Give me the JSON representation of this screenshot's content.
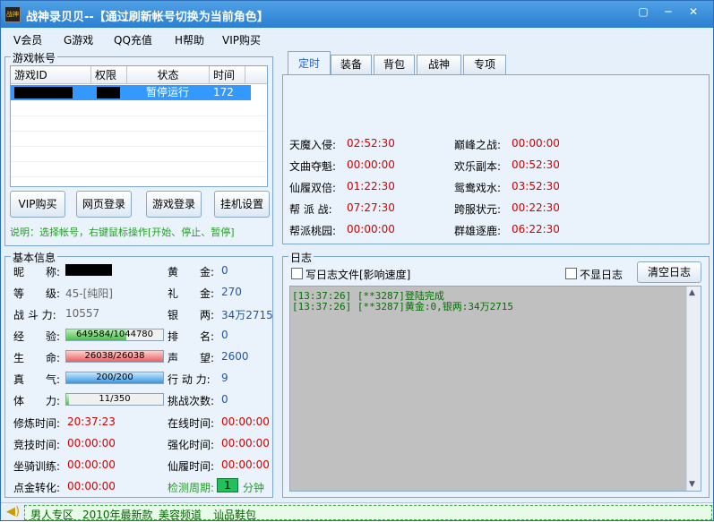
{
  "window": {
    "title": "战神录贝贝--【通过刷新帐号切换为当前角色】",
    "icon_label": "战神"
  },
  "menu": [
    "V会员",
    "G游戏",
    "QQ充值",
    "H帮助",
    "VIP购买"
  ],
  "accounts": {
    "title": "游戏帐号",
    "columns": [
      "游戏ID",
      "权限",
      "状态",
      "时间"
    ],
    "rows": [
      {
        "id": "",
        "perm": "",
        "status": "暂停运行",
        "time": "172"
      }
    ],
    "buttons": [
      "VIP购买",
      "网页登录",
      "游戏登录",
      "挂机设置"
    ],
    "hint": "说明：选择帐号，右键鼠标操作[开始、停止、暂停]"
  },
  "tabs": [
    "定时",
    "装备",
    "背包",
    "战神",
    "专项"
  ],
  "timers": [
    {
      "label": "天魔入侵:",
      "value": "02:52:30"
    },
    {
      "label": "巅峰之战:",
      "value": "00:00:00"
    },
    {
      "label": "文曲夺魁:",
      "value": "00:00:00"
    },
    {
      "label": "欢乐副本:",
      "value": "00:52:30"
    },
    {
      "label": "仙履双倍:",
      "value": "01:22:30"
    },
    {
      "label": "鸳鸯戏水:",
      "value": "03:52:30"
    },
    {
      "label": "帮 派 战:",
      "value": "07:27:30"
    },
    {
      "label": "跨服状元:",
      "value": "00:22:30"
    },
    {
      "label": "帮派桃园:",
      "value": "00:00:00"
    },
    {
      "label": "群雄逐鹿:",
      "value": "06:22:30"
    }
  ],
  "basic": {
    "title": "基本信息",
    "nickname_label": "昵　　称:",
    "level_label": "等　　级:",
    "level": "45-[纯阳]",
    "power_label": "战 斗 力:",
    "power": "10557",
    "exp_label": "经　　验:",
    "exp": "649584/1044780",
    "exp_pct": 62,
    "hp_label": "生　　命:",
    "hp": "26038/26038",
    "hp_pct": 100,
    "qi_label": "真　　气:",
    "qi": "200/200",
    "qi_pct": 100,
    "stamina_label": "体　　力:",
    "stamina": "11/350",
    "stamina_pct": 3,
    "gold_label": "黄　　金:",
    "gold": "0",
    "gift_label": "礼　　金:",
    "gift": "270",
    "silver_label": "银　　两:",
    "silver": "34万2715",
    "rank_label": "排　　名:",
    "rank": "0",
    "fame_label": "声　　望:",
    "fame": "2600",
    "action_label": "行 动 力:",
    "action": "9",
    "challenge_label": "挑战次数:",
    "challenge": "0",
    "cultivate_label": "修炼时间:",
    "cultivate": "20:37:23",
    "online_label": "在线时间:",
    "online": "00:00:00",
    "arena_label": "竞技时间:",
    "arena": "00:00:00",
    "enhance_label": "强化时间:",
    "enhance": "00:00:00",
    "mount_label": "坐骑训练:",
    "mount": "00:00:00",
    "xianlv_label": "仙履时间:",
    "xianlv": "00:00:00",
    "dianjin_label": "点金转化:",
    "dianjin": "00:00:00",
    "check_label": "检测周期:",
    "check_value": "1",
    "check_unit": "分钟"
  },
  "log": {
    "title": "日志",
    "write_label": "写日志文件[影响速度]",
    "hide_label": "不显日志",
    "clear_label": "清空日志",
    "lines": [
      "[13:37:26] [**3287]登陆完成",
      "[13:37:26] [**3287]黄金:0,银两:34万2715"
    ]
  },
  "ads": [
    "男人专区",
    "2010年最新款",
    "美容频道",
    "讪品鞋包"
  ],
  "colors": {
    "accent": "#2a7fd0",
    "timer": "#d20000",
    "value": "#2255aa",
    "hint": "#20a020"
  }
}
